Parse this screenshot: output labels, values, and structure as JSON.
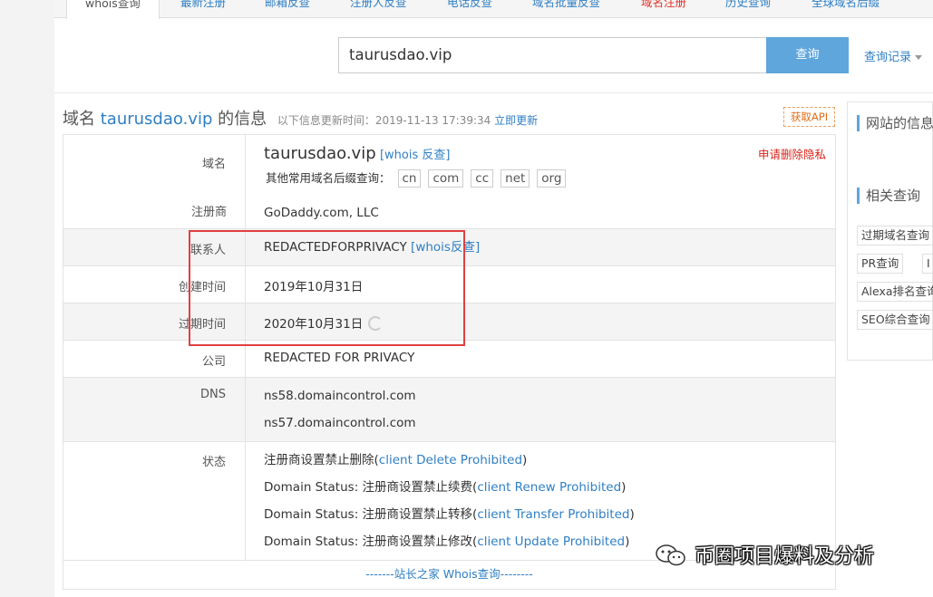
{
  "tabs": [
    {
      "label": "whois查询",
      "active": true
    },
    {
      "label": "最新注册"
    },
    {
      "label": "邮箱反查"
    },
    {
      "label": "注册人反查"
    },
    {
      "label": "电话反查"
    },
    {
      "label": "域名批量反查"
    },
    {
      "label": "域名注册",
      "red": true
    },
    {
      "label": "历史查询"
    },
    {
      "label": "全球域名后缀"
    }
  ],
  "search": {
    "value": "taurusdao.vip",
    "button": "查询",
    "history": "查询记录"
  },
  "header": {
    "prefix": "域名",
    "domain": "taurusdao.vip",
    "suffix": "的信息",
    "update_text": "以下信息更新时间：2019-11-13 17:39:34",
    "update_link": "立即更新",
    "api": "获取API"
  },
  "rows": {
    "domain": {
      "label": "域名",
      "value": "taurusdao.vip",
      "whois_link": "[whois 反查]",
      "privacy": "申请删除隐私",
      "suffix_label": "其他常用域名后缀查询：",
      "suffixes": [
        "cn",
        "com",
        "cc",
        "net",
        "org"
      ]
    },
    "registrar": {
      "label": "注册商",
      "value": "GoDaddy.com, LLC"
    },
    "contact": {
      "label": "联系人",
      "value": "REDACTEDFORPRIVACY",
      "link": "[whois反查]"
    },
    "created": {
      "label": "创建时间",
      "value": "2019年10月31日"
    },
    "expires": {
      "label": "过期时间",
      "value": "2020年10月31日"
    },
    "company": {
      "label": "公司",
      "value": "REDACTED FOR PRIVACY"
    },
    "dns": {
      "label": "DNS",
      "values": [
        "ns58.domaincontrol.com",
        "ns57.domaincontrol.com"
      ]
    },
    "status": {
      "label": "状态",
      "lines": [
        {
          "prefix": "注册商设置禁止删除(",
          "link": "client Delete Prohibited",
          "end": ")"
        },
        {
          "prefix": "Domain Status: 注册商设置禁止续费(",
          "link": "client Renew Prohibited",
          "end": ")"
        },
        {
          "prefix": "Domain Status: 注册商设置禁止转移(",
          "link": "client Transfer Prohibited",
          "end": ")"
        },
        {
          "prefix": "Domain Status: 注册商设置禁止修改(",
          "link": "client Update Prohibited",
          "end": ")"
        }
      ]
    },
    "footer": "-------站长之家 Whois查询--------"
  },
  "sidebar": {
    "title1": "网站的信息",
    "title2": "相关查询",
    "chips": [
      "过期域名查询",
      "PR查询",
      "I",
      "Alexa排名查询",
      "SEO综合查询"
    ]
  },
  "watermark": "币圈项目爆料及分析",
  "colors": {
    "accent": "#2f7fc4",
    "button": "#5fa6dd",
    "highlight": "#e04040",
    "privacy": "#d8251b"
  }
}
